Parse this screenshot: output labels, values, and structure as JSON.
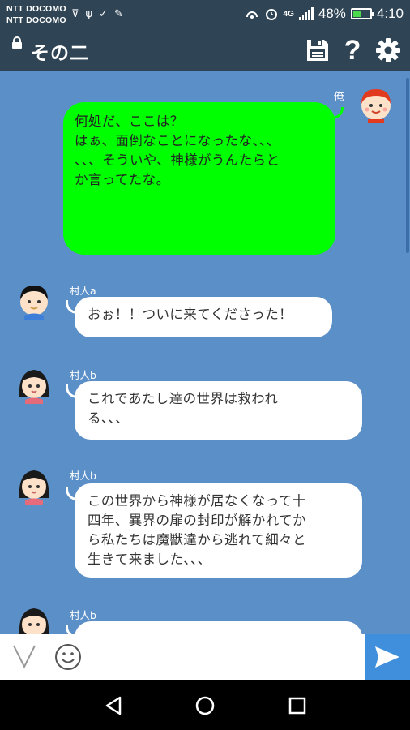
{
  "status_bar": {
    "carrier_line1": "NTT DOCOMO",
    "carrier_line2": "NTT DOCOMO",
    "battery_text": "48%",
    "battery_level": 0.48,
    "time": "4:10"
  },
  "title_bar": {
    "title": "その二",
    "icons": [
      "lock-icon",
      "save-icon",
      "help-icon",
      "settings-icon"
    ],
    "help_label": "?"
  },
  "messages": [
    {
      "sender": "俺",
      "side": "right",
      "lines": [
        "何処だ、ここは？",
        "",
        "はぁ、面倒なことになったな、、、",
        "",
        "",
        "、、、そういや、神様がうんたらと",
        "か言ってたな。"
      ]
    },
    {
      "sender": "村人a",
      "side": "left",
      "lines": [
        "おぉ！！ついに来てくださった！"
      ]
    },
    {
      "sender": "村人b",
      "side": "left",
      "lines": [
        "これであたし達の世界は救われ",
        "る、、、"
      ]
    },
    {
      "sender": "村人b",
      "side": "left",
      "lines": [
        "この世界から神様が居なくなって十",
        "四年、異界の扉の封印が解かれてか",
        "ら私たちは魔獣達から逃れて細々と",
        "生きて来ました、、、"
      ]
    },
    {
      "sender": "村人b",
      "side": "left",
      "lines": [
        "",
        ""
      ]
    }
  ],
  "input_bar": {
    "placeholder": "",
    "value": "",
    "v_button_label": "V"
  },
  "colors": {
    "bar_bg": "#2f4454",
    "chat_bg": "#5b8fc8",
    "my_bubble": "#00ff00",
    "other_bubble": "#ffffff",
    "send_button": "#3f8fdc"
  }
}
